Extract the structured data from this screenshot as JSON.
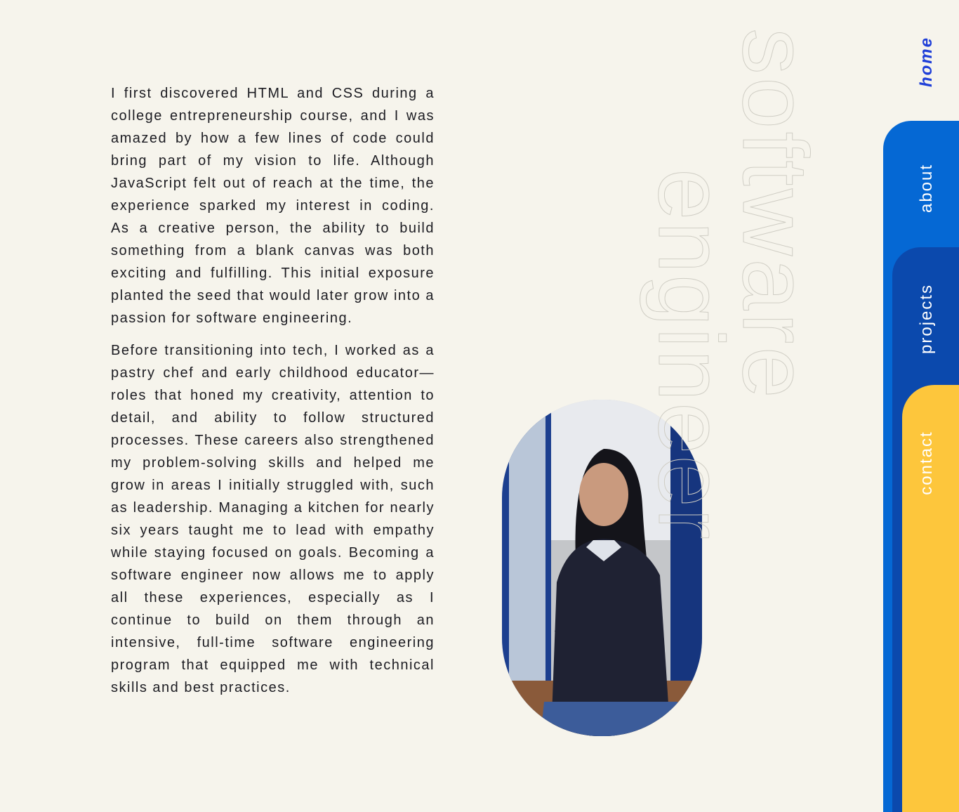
{
  "about": {
    "paragraphs": [
      "I first discovered HTML and CSS during a college entrepreneurship course, and I was amazed by how a few lines of code could bring part of my vision to life. Although JavaScript felt out of reach at the time, the experience sparked my interest in coding. As a creative person, the ability to build something from a blank canvas was both exciting and fulfilling.  This initial exposure planted the seed that would later grow into a passion for software engineering.",
      "Before transitioning into tech, I worked as a pastry chef and early childhood educator—roles that honed my creativity, attention to detail, and ability to follow structured processes. These careers also strengthened my problem-solving skills and helped me grow in areas I initially struggled with, such as leadership. Managing a kitchen for nearly six years taught me to lead with empathy while staying focused on goals. Becoming a software engineer now allows me to apply all these experiences, especially as I continue to build on them through an intensive, full-time software engineering program that equipped me with technical skills and best practices."
    ]
  },
  "heading": {
    "line1": "software",
    "line2": "engineer"
  },
  "nav": {
    "home": "home",
    "about": "about",
    "projects": "projects",
    "contact": "contact"
  },
  "colors": {
    "background": "#f6f4ec",
    "about_tab": "#0568d4",
    "projects_tab": "#0b49ad",
    "contact_tab": "#fdc63c",
    "home_link": "#1f3fd8"
  }
}
